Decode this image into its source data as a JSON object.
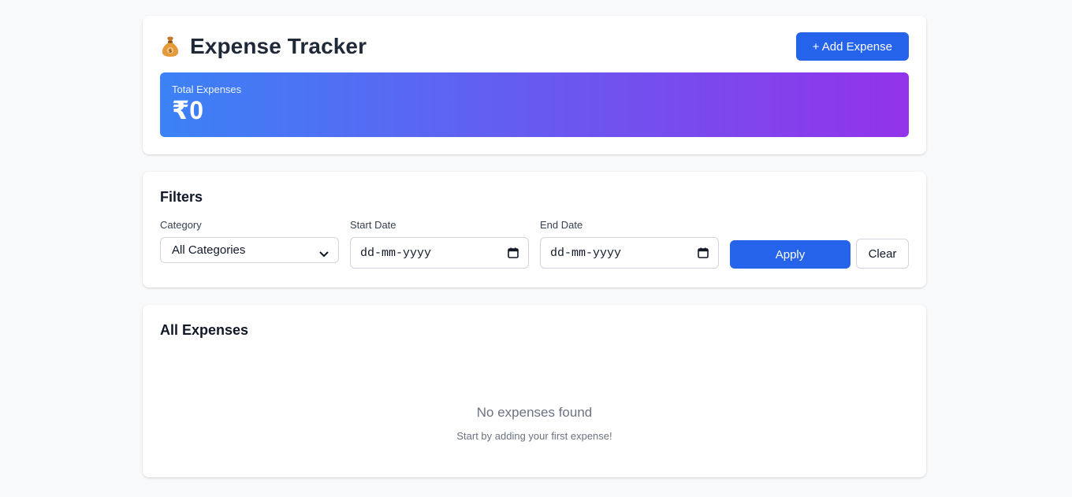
{
  "header": {
    "title": "Expense Tracker",
    "icon": "money-bag-icon",
    "add_button_label": "+ Add Expense"
  },
  "summary": {
    "label": "Total Expenses",
    "value": "₹0",
    "gradient_from": "#3b82f6",
    "gradient_to": "#9333ea"
  },
  "filters": {
    "title": "Filters",
    "category": {
      "label": "Category",
      "selected": "All Categories"
    },
    "start_date": {
      "label": "Start Date",
      "placeholder": "dd-mm-yyyy"
    },
    "end_date": {
      "label": "End Date",
      "placeholder": "dd-mm-yyyy"
    },
    "apply_label": "Apply",
    "clear_label": "Clear"
  },
  "expenses": {
    "title": "All Expenses",
    "empty_title": "No expenses found",
    "empty_subtitle": "Start by adding your first expense!"
  },
  "colors": {
    "accent": "#2563eb",
    "background": "#f8f9fb"
  }
}
